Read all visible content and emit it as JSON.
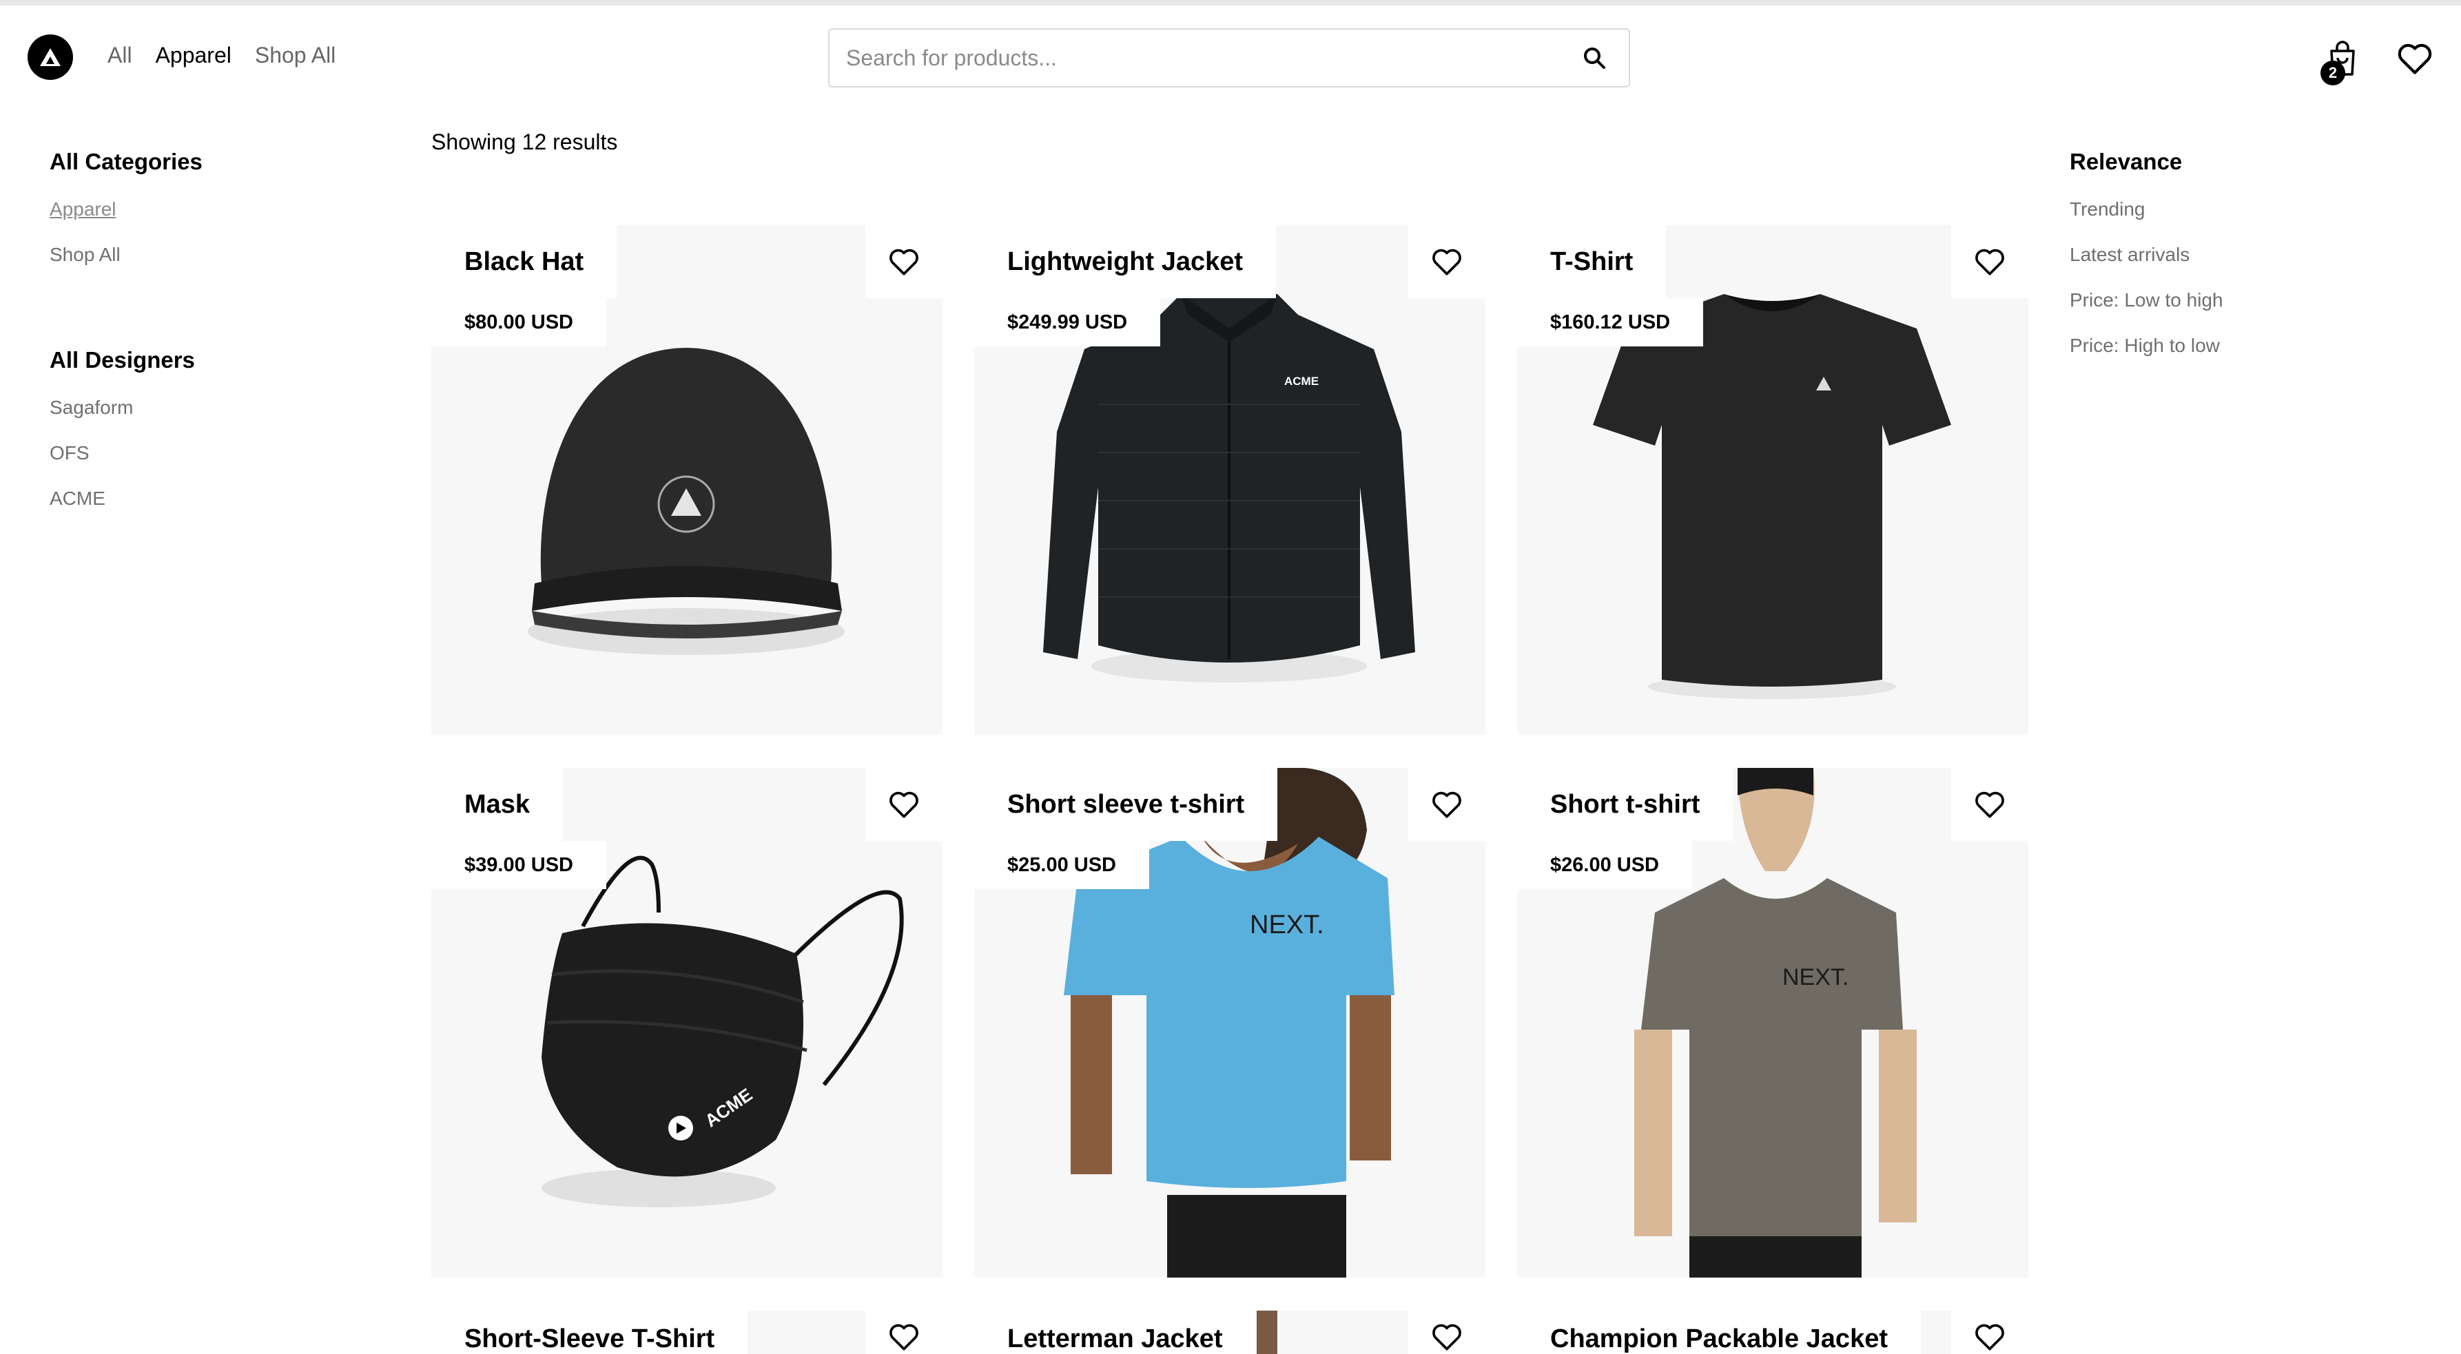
{
  "header": {
    "nav": [
      "All",
      "Apparel",
      "Shop All"
    ],
    "active_nav": "Apparel",
    "search_placeholder": "Search for products...",
    "cart_count": "2"
  },
  "results_text": "Showing 12 results",
  "sidebar": {
    "categories_title": "All Categories",
    "categories": [
      "Apparel",
      "Shop All"
    ],
    "designers_title": "All Designers",
    "designers": [
      "Sagaform",
      "OFS",
      "ACME"
    ]
  },
  "sort": {
    "title": "Relevance",
    "options": [
      "Trending",
      "Latest arrivals",
      "Price: Low to high",
      "Price: High to low"
    ]
  },
  "products": [
    {
      "name": "Black Hat",
      "price": "$80.00 USD",
      "image": "beanie",
      "logo_text": ""
    },
    {
      "name": "Lightweight Jacket",
      "price": "$249.99 USD",
      "image": "jacket",
      "logo_text": "ACME"
    },
    {
      "name": "T-Shirt",
      "price": "$160.12 USD",
      "image": "tshirt",
      "logo_text": ""
    },
    {
      "name": "Mask",
      "price": "$39.00 USD",
      "image": "mask",
      "logo_text": "ACME"
    },
    {
      "name": "Short sleeve t-shirt",
      "price": "$25.00 USD",
      "image": "blue-tee-model",
      "logo_text": "NEXT."
    },
    {
      "name": "Short t-shirt",
      "price": "$26.00 USD",
      "image": "grey-tee-model",
      "logo_text": "NEXT."
    },
    {
      "name": "Short-Sleeve T-Shirt",
      "price": "",
      "image": "partial"
    },
    {
      "name": "Letterman Jacket",
      "price": "",
      "image": "partial"
    },
    {
      "name": "Champion Packable Jacket",
      "price": "",
      "image": "partial"
    }
  ],
  "colors": {
    "accent": "#000000",
    "muted_text": "#6f6f6f",
    "card_bg": "#f7f7f7",
    "blue_tee": "#5ab0dc",
    "grey_tee": "#6f6b63"
  }
}
